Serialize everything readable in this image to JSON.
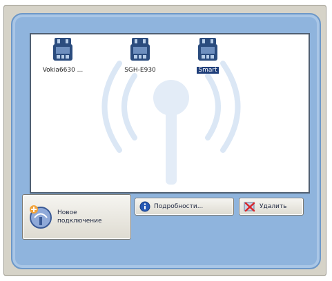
{
  "devices": [
    {
      "label": "Vokia6630 ...",
      "icon": "phone-device-icon",
      "selected": false
    },
    {
      "label": "SGH-E930",
      "icon": "phone-device-icon",
      "selected": false
    },
    {
      "label": "Smart",
      "icon": "phone-device-icon",
      "selected": true
    }
  ],
  "buttons": {
    "new_connection": "Новое подключение",
    "details": "Подробности...",
    "delete": "Удалить"
  },
  "colors": {
    "panel_blue": "#8fb4dd",
    "selection": "#1f3e7a",
    "device_icon": "#2b4c7e"
  }
}
